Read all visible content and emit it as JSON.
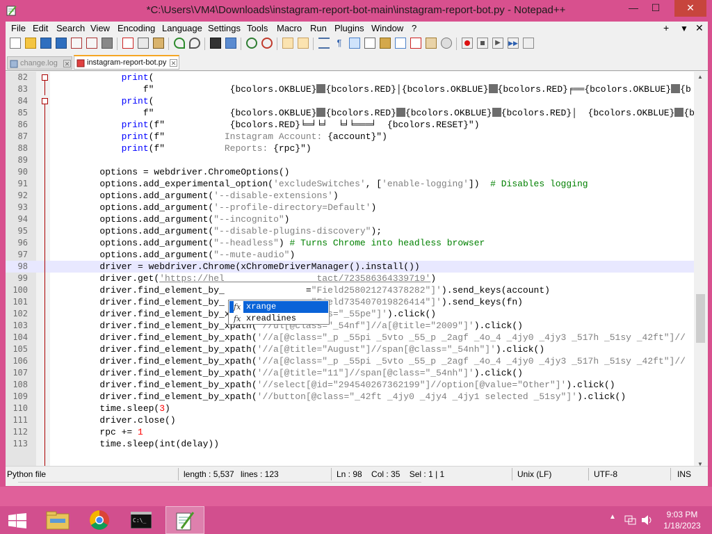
{
  "window": {
    "title": "*C:\\Users\\VM4\\Downloads\\instagram-report-bot-main\\instagram-report-bot.py - Notepad++",
    "min_label": "—",
    "max_label": "☐",
    "close_label": "✕"
  },
  "menu": {
    "items": [
      "File",
      "Edit",
      "Search",
      "View",
      "Encoding",
      "Language",
      "Settings",
      "Tools",
      "Macro",
      "Run",
      "Plugins",
      "Window",
      "?"
    ],
    "plus_label": "+",
    "down_label": "▼",
    "close_label": "✕"
  },
  "tabs": [
    {
      "label": "change.log",
      "active": false
    },
    {
      "label": "instagram-report-bot.py",
      "active": true
    }
  ],
  "editor": {
    "lines": [
      {
        "num": "82",
        "html": "            <span class=\"kw\">print</span>("
      },
      {
        "num": "83",
        "html": "                f\"              {bcolors.OKBLUE}<span class=\"block\"></span>{bcolors.RED}│{bcolors.OKBLUE}<span class=\"block\"></span>{bcolors.RED}╒══{bcolors.OKBLUE}<span class=\"block\"></span>{b"
      },
      {
        "num": "84",
        "html": "            <span class=\"kw\">print</span>("
      },
      {
        "num": "85",
        "html": "                f\"              {bcolors.OKBLUE}<span class=\"block\"></span>{bcolors.RED}<span class=\"block\"></span>{bcolors.OKBLUE}<span class=\"block\"></span>{bcolors.RED}│  {bcolors.OKBLUE}<span class=\"block\"></span>{b"
      },
      {
        "num": "86",
        "html": "            <span class=\"kw\">print</span>(f\"            {bcolors.RED}╘═╛╘╛  ╘╛╘═══╛  {bcolors.RESET}\")"
      },
      {
        "num": "87",
        "html": "            <span class=\"kw\">print</span>(f\"           <span class=\"st\">Instagram Account: </span>{account}\")"
      },
      {
        "num": "88",
        "html": "            <span class=\"kw\">print</span>(f\"           <span class=\"st\">Reports: </span>{rpc}\")"
      },
      {
        "num": "89",
        "html": ""
      },
      {
        "num": "90",
        "html": "        options = webdriver.ChromeOptions()"
      },
      {
        "num": "91",
        "html": "        options.add_experimental_option(<span class=\"st\">'excludeSwitches'</span>, [<span class=\"st\">'enable-logging'</span>])  <span class=\"cm\"># Disables logging</span>"
      },
      {
        "num": "92",
        "html": "        options.add_argument(<span class=\"st\">'--disable-extensions'</span>)"
      },
      {
        "num": "93",
        "html": "        options.add_argument(<span class=\"st\">'--profile-directory=Default'</span>)"
      },
      {
        "num": "94",
        "html": "        options.add_argument(<span class=\"st\">\"--incognito\"</span>)"
      },
      {
        "num": "95",
        "html": "        options.add_argument(<span class=\"st\">\"--disable-plugins-discovery\"</span>);"
      },
      {
        "num": "96",
        "html": "        options.add_argument(<span class=\"st\">\"--headless\"</span>) <span class=\"cm\"># Turns Chrome into headless browser</span>"
      },
      {
        "num": "97",
        "html": "        options.add_argument(<span class=\"st\">\"--mute-audio\"</span>)"
      },
      {
        "num": "98",
        "html": "        driver = webdriver.Chrome(xChromeDriverManager().install())"
      },
      {
        "num": "99",
        "html": "        driver.get(<span class=\"ul\">'https://hel                 tact/723586364339719'</span>)"
      },
      {
        "num": "100",
        "html": "        driver.find_element_by_               =<span class=\"st\">\"Field258021274378282\"]'</span>).send_keys(account)"
      },
      {
        "num": "101",
        "html": "        driver.find_element_by_               =<span class=\"st\">\"Field735407019826414\"]'</span>).send_keys(fn)"
      },
      {
        "num": "102",
        "html": "        driver.find_element_by_xpath(<span class=\"st\">'//span[@class=\"_55pe\"]'</span>).click()"
      },
      {
        "num": "103",
        "html": "        driver.find_element_by_xpath(<span class=\"st\">'//ul[@class=\"_54nf\"]//a[@title=\"2009\"]'</span>).click()"
      },
      {
        "num": "104",
        "html": "        driver.find_element_by_xpath(<span class=\"st\">'//a[@class=\"_p _55pi _5vto _55_p _2agf _4o_4 _4jy0 _4jy3 _517h _51sy _42ft\"]//</span>"
      },
      {
        "num": "105",
        "html": "        driver.find_element_by_xpath(<span class=\"st\">'//a[@title=\"August\"]//span[@class=\"_54nh\"]'</span>).click()"
      },
      {
        "num": "106",
        "html": "        driver.find_element_by_xpath(<span class=\"st\">'//a[@class=\"_p _55pi _5vto _55_p _2agf _4o_4 _4jy0 _4jy3 _517h _51sy _42ft\"]//</span>"
      },
      {
        "num": "107",
        "html": "        driver.find_element_by_xpath(<span class=\"st\">'//a[@title=\"11\"]//span[@class=\"_54nh\"]'</span>).click()"
      },
      {
        "num": "108",
        "html": "        driver.find_element_by_xpath(<span class=\"st\">'//select[@id=\"294540267362199\"]//option[@value=\"Other\"]'</span>).click()"
      },
      {
        "num": "109",
        "html": "        driver.find_element_by_xpath(<span class=\"st\">'//button[@class=\"_42ft _4jy0 _4jy4 _4jy1 selected _51sy\"]'</span>).click()"
      },
      {
        "num": "110",
        "html": "        time.sleep(<span class=\"nm\">3</span>)"
      },
      {
        "num": "111",
        "html": "        driver.close()"
      },
      {
        "num": "112",
        "html": "        rpc += <span class=\"nm\">1</span>"
      },
      {
        "num": "113",
        "html": "        time.sleep(int(delay))"
      }
    ],
    "current_line": "98"
  },
  "autocomplete": {
    "items": [
      {
        "icon": "fx",
        "label": "xrange",
        "selected": true
      },
      {
        "icon": "fx",
        "label": "xreadlines",
        "selected": false
      }
    ]
  },
  "status": {
    "filetype": "Python file",
    "length": "length : 5,537",
    "lines": "lines : 123",
    "position": "Ln : 98    Col : 35    Sel : 1 | 1",
    "eol": "Unix (LF)",
    "encoding": "UTF-8",
    "mode": "INS"
  },
  "taskbar": {
    "time": "9:03 PM",
    "date": "1/18/2023"
  },
  "colors": {
    "window_frame": "#d8508e",
    "taskbar": "#d24f8e",
    "selection": "#0a63d8",
    "keyword": "#0000ff",
    "string": "#808080",
    "comment": "#008000"
  }
}
